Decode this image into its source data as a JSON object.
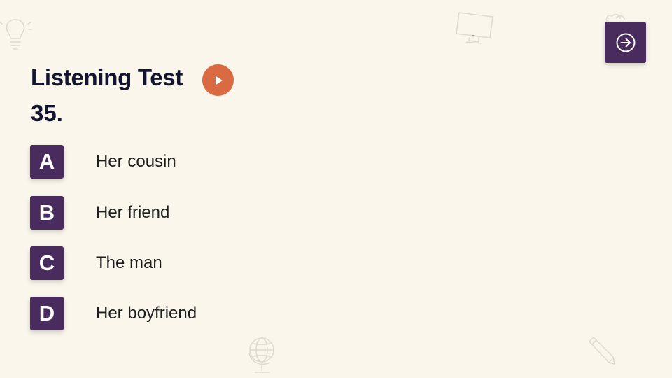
{
  "header": {
    "title": "Listening Test",
    "question_number": "35."
  },
  "options": [
    {
      "letter": "A",
      "text": "Her cousin"
    },
    {
      "letter": "B",
      "text": "Her friend"
    },
    {
      "letter": "C",
      "text": "The man"
    },
    {
      "letter": "D",
      "text": "Her boyfriend"
    }
  ],
  "icons": {
    "next": "arrow-right-circle-icon",
    "play": "play-icon",
    "decorations": [
      "lightbulb-icon",
      "monitor-icon",
      "heart-icon",
      "globe-icon",
      "pencil-icon"
    ]
  },
  "colors": {
    "background": "#faf6ec",
    "accent_purple": "#4a2b5e",
    "play_orange": "#d96a42",
    "title_text": "#13142f"
  }
}
